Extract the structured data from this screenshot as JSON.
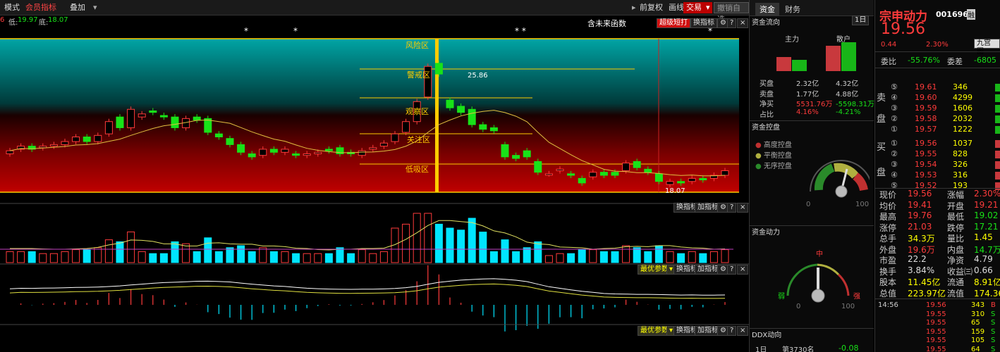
{
  "toolbar": {
    "mode": "模式",
    "member": "会员指标",
    "overlay": "叠加",
    "prev_adjust": "前复权",
    "draw": "画线",
    "trade": "交易",
    "undo": "撤销自选"
  },
  "info": {
    "prefix": "6",
    "low_label": "低:",
    "low_value": "19.97",
    "floor_label": "底:",
    "floor_value": "18.07"
  },
  "chart_header": {
    "future_func": "含未来函数",
    "super_short": "超级短打",
    "switch_indicator": "换指标"
  },
  "zones": {
    "risk": "风险区",
    "warning": "警戒区",
    "watch": "观察区",
    "focus": "关注区",
    "absorb": "低吸区"
  },
  "price_labels": {
    "high": "25.86",
    "low": "18.07"
  },
  "chart_data": {
    "type": "candlestick",
    "high_mark": 25.86,
    "low_mark": 18.07,
    "candles": [
      [
        18.9,
        19.1
      ],
      [
        19.2,
        19.4
      ],
      [
        19.4,
        19.2
      ],
      [
        19.3,
        19.4
      ],
      [
        19.4,
        19.5
      ],
      [
        19.5,
        19.7
      ],
      [
        19.7,
        20.0
      ],
      [
        20.0,
        19.7
      ],
      [
        19.7,
        20.1
      ],
      [
        20.2,
        21.0
      ],
      [
        21.3,
        20.6
      ],
      [
        20.6,
        21.8
      ],
      [
        21.3,
        21.5
      ],
      [
        21.7,
        21.6
      ],
      [
        21.4,
        21.3
      ],
      [
        21.3,
        20.6
      ],
      [
        20.6,
        21.2
      ],
      [
        21.3,
        21.1
      ],
      [
        21.2,
        20.3
      ],
      [
        20.2,
        20.0
      ],
      [
        19.9,
        19.5
      ],
      [
        19.5,
        19.0
      ],
      [
        18.9,
        18.7
      ],
      [
        18.8,
        19.2
      ],
      [
        19.2,
        19.0
      ],
      [
        19.0,
        19.2
      ],
      [
        18.9,
        18.8
      ],
      [
        18.8,
        18.9
      ],
      [
        18.9,
        19.0
      ],
      [
        19.2,
        19.1
      ],
      [
        19.3,
        18.9
      ],
      [
        19.0,
        18.9
      ],
      [
        18.8,
        19.1
      ],
      [
        19.2,
        19.3
      ],
      [
        19.4,
        19.6
      ],
      [
        19.7,
        20.2
      ],
      [
        20.3,
        21.0
      ],
      [
        21.0,
        22.3
      ],
      [
        22.6,
        24.6
      ],
      [
        24.8,
        24.1
      ],
      [
        22.4,
        21.9
      ],
      [
        22.0,
        21.6
      ],
      [
        21.8,
        20.8
      ],
      [
        20.8,
        20.5
      ],
      [
        20.6,
        20.4
      ],
      [
        19.5,
        18.7
      ],
      [
        18.8,
        18.6
      ],
      [
        19.1,
        18.7
      ],
      [
        18.4,
        17.7
      ],
      [
        17.6,
        17.6
      ],
      [
        17.8,
        17.9
      ],
      [
        17.6,
        17.5
      ],
      [
        17.3,
        17.0
      ],
      [
        17.4,
        17.7
      ],
      [
        17.7,
        17.5
      ],
      [
        17.7,
        17.5
      ],
      [
        17.8,
        18.3
      ],
      [
        18.4,
        18.0
      ],
      [
        17.9,
        17.7
      ],
      [
        17.6,
        17.1
      ],
      [
        16.9,
        17.1
      ],
      [
        17.1,
        17.0
      ],
      [
        17.1,
        17.3
      ],
      [
        17.3,
        17.2
      ],
      [
        17.3,
        17.5
      ],
      [
        17.5,
        17.8
      ]
    ]
  },
  "sub1": {
    "switch": "换指标",
    "add": "加指标"
  },
  "sub2": {
    "optimal": "最优参数",
    "switch": "换指标",
    "add": "加指标"
  },
  "sub3": {
    "optimal": "最优参数",
    "switch": "换指标",
    "add": "加指标"
  },
  "capital": {
    "tab1": "资金",
    "tab2": "财务",
    "flow_title": "资金流向",
    "period": "1日",
    "main_label": "主力",
    "retail_label": "散户",
    "rows": [
      {
        "label": "买盘",
        "v1": "2.32亿",
        "v2": "4.32亿"
      },
      {
        "label": "卖盘",
        "v1": "1.77亿",
        "v2": "4.88亿"
      },
      {
        "label": "净买",
        "v1": "5531.76万",
        "v2": "-5598.31万"
      },
      {
        "label": "占比",
        "v1": "4.16%",
        "v2": "-4.21%"
      }
    ],
    "control_title": "资金控盘",
    "legend": [
      "高度控盘",
      "平衡控盘",
      "无序控盘"
    ],
    "gauge1_min": "0",
    "gauge1_max": "100",
    "power_title": "资金动力",
    "gauge2_mid": "中",
    "gauge2_weak": "弱",
    "gauge2_strong": "强",
    "gauge2_min": "0",
    "gauge2_max": "100",
    "ddx_title": "DDX动向",
    "ddx_period": "1日",
    "ddx_rank": "第3730名",
    "ddx_value": "-0.08"
  },
  "quote": {
    "name": "宗申动力",
    "code": "001696",
    "tag": "融",
    "price": "19.56",
    "change": "0.44",
    "pct": "2.30%",
    "ninegrid": "九宫图",
    "wb_label": "委比",
    "wb_value": "-55.76%",
    "wc_label": "委差",
    "wc_value": "-6805",
    "sell_side": "卖",
    "sell_side2": "盘",
    "buy_side": "买",
    "buy_side2": "盘",
    "asks": [
      {
        "n": "⑤",
        "p": "19.61",
        "v": "346"
      },
      {
        "n": "④",
        "p": "19.60",
        "v": "4299"
      },
      {
        "n": "③",
        "p": "19.59",
        "v": "1606"
      },
      {
        "n": "②",
        "p": "19.58",
        "v": "2032"
      },
      {
        "n": "①",
        "p": "19.57",
        "v": "1222"
      }
    ],
    "bids": [
      {
        "n": "①",
        "p": "19.56",
        "v": "1037"
      },
      {
        "n": "②",
        "p": "19.55",
        "v": "828"
      },
      {
        "n": "③",
        "p": "19.54",
        "v": "326"
      },
      {
        "n": "④",
        "p": "19.53",
        "v": "316"
      },
      {
        "n": "⑤",
        "p": "19.52",
        "v": "193"
      }
    ],
    "stats": [
      {
        "l1": "现价",
        "v1": "19.56",
        "c1": "red",
        "l2": "涨幅",
        "v2": "2.30%",
        "c2": "red"
      },
      {
        "l1": "均价",
        "v1": "19.41",
        "c1": "red",
        "l2": "开盘",
        "v2": "19.21",
        "c2": "red"
      },
      {
        "l1": "最高",
        "v1": "19.76",
        "c1": "red",
        "l2": "最低",
        "v2": "19.02",
        "c2": "grn"
      },
      {
        "l1": "涨停",
        "v1": "21.03",
        "c1": "red",
        "l2": "跌停",
        "v2": "17.21",
        "c2": "grn"
      },
      {
        "l1": "总手",
        "v1": "34.3万",
        "c1": "yel",
        "l2": "量比",
        "v2": "1.45",
        "c2": "yel"
      },
      {
        "l1": "外盘",
        "v1": "19.6万",
        "c1": "red",
        "l2": "内盘",
        "v2": "14.7万",
        "c2": "grn"
      },
      {
        "l1": "市盈",
        "v1": "22.2",
        "c1": "wht",
        "l2": "净资",
        "v2": "4.79",
        "c2": "wht"
      },
      {
        "l1": "换手",
        "v1": "3.84%",
        "c1": "wht",
        "l2": "收益㈢",
        "v2": "0.66",
        "c2": "wht"
      },
      {
        "l1": "股本",
        "v1": "11.45亿",
        "c1": "yel",
        "l2": "流通",
        "v2": "8.91亿",
        "c2": "yel"
      },
      {
        "l1": "总值",
        "v1": "223.97亿",
        "c1": "yel",
        "l2": "流值",
        "v2": "174.36亿",
        "c2": "yel"
      }
    ],
    "ticks": [
      {
        "t": "14:56",
        "p": "19.56",
        "v": "343",
        "s": "B"
      },
      {
        "t": "",
        "p": "19.55",
        "v": "310",
        "s": "S"
      },
      {
        "t": "",
        "p": "19.55",
        "v": "65",
        "s": "S"
      },
      {
        "t": "",
        "p": "19.55",
        "v": "159",
        "s": "S"
      },
      {
        "t": "",
        "p": "19.55",
        "v": "105",
        "s": "S"
      },
      {
        "t": "",
        "p": "19.55",
        "v": "64",
        "s": "S"
      }
    ]
  }
}
